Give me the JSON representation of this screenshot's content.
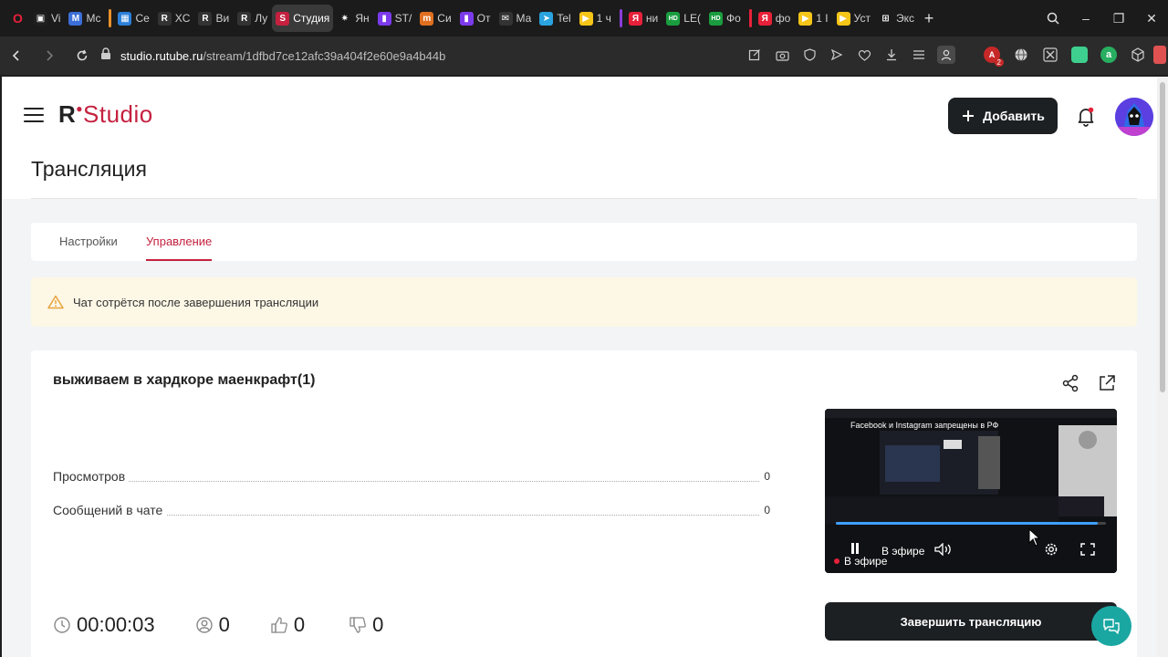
{
  "browser": {
    "tabs": [
      {
        "label": "Vi",
        "icon": "twitch-icon",
        "color": "#1f1f1f",
        "glyph": "▣"
      },
      {
        "label": "Mc",
        "icon": "m-icon",
        "color": "#3c6fd8",
        "glyph": "M"
      },
      {
        "label": "Ce",
        "icon": "grid-icon",
        "color": "#2b7fd8",
        "glyph": "▦"
      },
      {
        "label": "XC",
        "icon": "rutube-icon",
        "color": "#333",
        "glyph": "R"
      },
      {
        "label": "Ви",
        "icon": "rutube-icon",
        "color": "#333",
        "glyph": "R"
      },
      {
        "label": "Лу",
        "icon": "rutube-icon",
        "color": "#333",
        "glyph": "R"
      },
      {
        "label": "Студия",
        "icon": "studio-icon",
        "color": "#c5213f",
        "glyph": "S"
      },
      {
        "label": "Ян",
        "icon": "sun-icon",
        "color": "#1b1b1b",
        "glyph": "✷"
      },
      {
        "label": "ST/",
        "icon": "twitch-icon",
        "color": "#7c3aed",
        "glyph": "▮"
      },
      {
        "label": "Си",
        "icon": "m-icon",
        "color": "#e07020",
        "glyph": "m"
      },
      {
        "label": "От",
        "icon": "twitch-icon",
        "color": "#7c3aed",
        "glyph": "▮"
      },
      {
        "label": "Ма",
        "icon": "mail-icon",
        "color": "#333",
        "glyph": "✉"
      },
      {
        "label": "Tel",
        "icon": "telegram-icon",
        "color": "#2aa3e0",
        "glyph": "➤"
      },
      {
        "label": "1 ч",
        "icon": "play-icon",
        "color": "#f5c518",
        "glyph": "▶"
      },
      {
        "label": "ни",
        "icon": "yandex-icon",
        "color": "#e8213a",
        "glyph": "Я"
      },
      {
        "label": "LE(",
        "icon": "hd-icon",
        "color": "#1a9d3f",
        "glyph": "HD"
      },
      {
        "label": "Фо",
        "icon": "hd-icon",
        "color": "#1a9d3f",
        "glyph": "HD"
      },
      {
        "label": "фо",
        "icon": "yandex-icon",
        "color": "#e8213a",
        "glyph": "Я"
      },
      {
        "label": "1 I",
        "icon": "play-icon",
        "color": "#f5c518",
        "glyph": "▶"
      },
      {
        "label": "Уст",
        "icon": "play-icon",
        "color": "#f5c518",
        "glyph": "▶"
      },
      {
        "label": "Экс",
        "icon": "grid-icon",
        "color": "#1b1b1b",
        "glyph": "⊞"
      }
    ],
    "url_host": "studio.rutube.ru",
    "url_path": "/stream/1dfbd7ce12afc39a404f2e60e9a4b44b",
    "ext_badge": "2"
  },
  "header": {
    "logo_prefix": "R",
    "logo_name": "Studio",
    "add_label": "Добавить"
  },
  "page": {
    "title": "Трансляция",
    "tabs": [
      {
        "label": "Настройки",
        "active": false
      },
      {
        "label": "Управление",
        "active": true
      }
    ],
    "warning": "Чат сотрётся после завершения трансляции"
  },
  "stream": {
    "title": "выживаем в хардкоре маенкрафт(1)",
    "stats": [
      {
        "label": "Просмотров",
        "value": "0"
      },
      {
        "label": "Сообщений в чате",
        "value": "0"
      }
    ],
    "player": {
      "notice": "Facebook и Instagram запрещены в РФ",
      "live_overlay": "В эфире",
      "live_badge": "В эфире",
      "progress": 0.97
    },
    "end_label": "Завершить трансляцию",
    "duration": "00:00:03",
    "viewers": "0",
    "likes": "0",
    "dislikes": "0"
  },
  "colors": {
    "brand": "#c5213f",
    "dark_button": "#1d2023",
    "warning_bg": "#fdf7e6",
    "fab": "#1aa7a2"
  }
}
